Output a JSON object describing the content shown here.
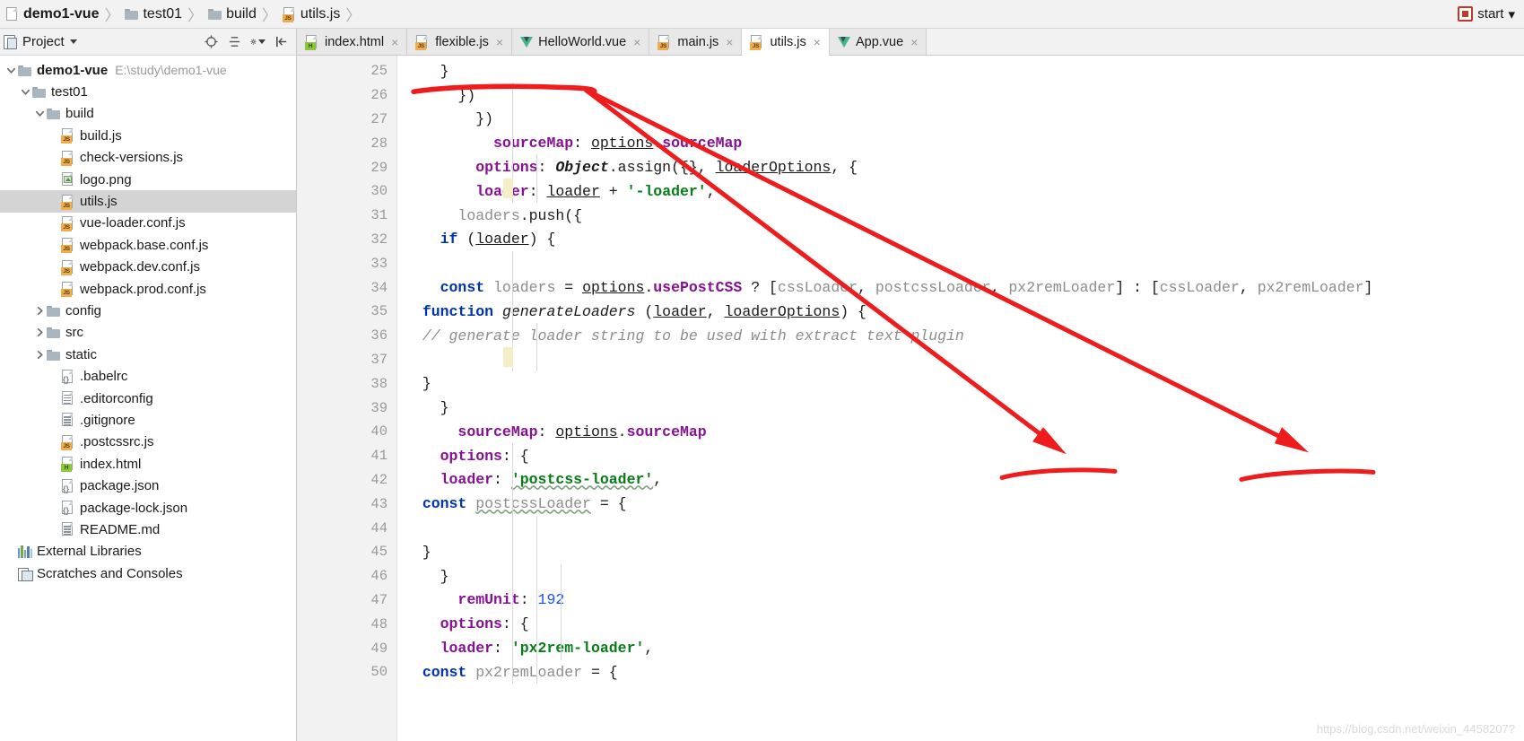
{
  "breadcrumb": {
    "items": [
      {
        "label": "demo1-vue",
        "icon": "module-icon",
        "bold": true
      },
      {
        "label": "test01",
        "icon": "folder-icon",
        "bold": false
      },
      {
        "label": "build",
        "icon": "folder-icon",
        "bold": false
      },
      {
        "label": "utils.js",
        "icon": "js-file-icon",
        "bold": false
      }
    ],
    "separator": "〉",
    "run_config": {
      "label": "start",
      "icon": "run-config-icon",
      "caret": "▾"
    }
  },
  "tool_window": {
    "title": "Project",
    "caret": "▾",
    "actions": [
      {
        "name": "locate-icon",
        "glyph": "⊕"
      },
      {
        "name": "expand-collapse-icon",
        "glyph": "≡"
      },
      {
        "name": "settings-gear-icon",
        "glyph": "⚙"
      },
      {
        "name": "hide-panel-icon",
        "glyph": "⇤"
      }
    ]
  },
  "tree": {
    "items": [
      {
        "label": "demo1-vue",
        "note": "E:\\study\\demo1-vue",
        "icon": "folder-icon",
        "indent": 0,
        "twisty": "down",
        "bold": true,
        "selected": false
      },
      {
        "label": "test01",
        "note": "",
        "icon": "folder-icon",
        "indent": 1,
        "twisty": "down",
        "bold": false,
        "selected": false
      },
      {
        "label": "build",
        "note": "",
        "icon": "folder-icon",
        "indent": 2,
        "twisty": "down",
        "bold": false,
        "selected": false
      },
      {
        "label": "build.js",
        "note": "",
        "icon": "js-file-icon",
        "indent": 3,
        "twisty": "none",
        "bold": false,
        "selected": false
      },
      {
        "label": "check-versions.js",
        "note": "",
        "icon": "js-file-icon",
        "indent": 3,
        "twisty": "none",
        "bold": false,
        "selected": false
      },
      {
        "label": "logo.png",
        "note": "",
        "icon": "image-file-icon",
        "indent": 3,
        "twisty": "none",
        "bold": false,
        "selected": false
      },
      {
        "label": "utils.js",
        "note": "",
        "icon": "js-file-icon",
        "indent": 3,
        "twisty": "none",
        "bold": false,
        "selected": true
      },
      {
        "label": "vue-loader.conf.js",
        "note": "",
        "icon": "js-file-icon",
        "indent": 3,
        "twisty": "none",
        "bold": false,
        "selected": false
      },
      {
        "label": "webpack.base.conf.js",
        "note": "",
        "icon": "js-file-icon",
        "indent": 3,
        "twisty": "none",
        "bold": false,
        "selected": false
      },
      {
        "label": "webpack.dev.conf.js",
        "note": "",
        "icon": "js-file-icon",
        "indent": 3,
        "twisty": "none",
        "bold": false,
        "selected": false
      },
      {
        "label": "webpack.prod.conf.js",
        "note": "",
        "icon": "js-file-icon",
        "indent": 3,
        "twisty": "none",
        "bold": false,
        "selected": false
      },
      {
        "label": "config",
        "note": "",
        "icon": "folder-icon",
        "indent": 2,
        "twisty": "right",
        "bold": false,
        "selected": false
      },
      {
        "label": "src",
        "note": "",
        "icon": "folder-icon",
        "indent": 2,
        "twisty": "right",
        "bold": false,
        "selected": false
      },
      {
        "label": "static",
        "note": "",
        "icon": "folder-icon",
        "indent": 2,
        "twisty": "right",
        "bold": false,
        "selected": false
      },
      {
        "label": ".babelrc",
        "note": "",
        "icon": "json-file-icon",
        "indent": 3,
        "twisty": "none",
        "bold": false,
        "selected": false
      },
      {
        "label": ".editorconfig",
        "note": "",
        "icon": "text-file-icon",
        "indent": 3,
        "twisty": "none",
        "bold": false,
        "selected": false
      },
      {
        "label": ".gitignore",
        "note": "",
        "icon": "text-file-icon",
        "indent": 3,
        "twisty": "none",
        "bold": false,
        "selected": false
      },
      {
        "label": ".postcssrc.js",
        "note": "",
        "icon": "js-file-icon",
        "indent": 3,
        "twisty": "none",
        "bold": false,
        "selected": false
      },
      {
        "label": "index.html",
        "note": "",
        "icon": "html-file-icon",
        "indent": 3,
        "twisty": "none",
        "bold": false,
        "selected": false
      },
      {
        "label": "package.json",
        "note": "",
        "icon": "json-file-icon",
        "indent": 3,
        "twisty": "none",
        "bold": false,
        "selected": false
      },
      {
        "label": "package-lock.json",
        "note": "",
        "icon": "json-file-icon",
        "indent": 3,
        "twisty": "none",
        "bold": false,
        "selected": false
      },
      {
        "label": "README.md",
        "note": "",
        "icon": "text-file-icon",
        "indent": 3,
        "twisty": "none",
        "bold": false,
        "selected": false
      },
      {
        "label": "External Libraries",
        "note": "",
        "icon": "libraries-icon",
        "indent": 0,
        "twisty": "none",
        "bold": false,
        "selected": false
      },
      {
        "label": "Scratches and Consoles",
        "note": "",
        "icon": "scratches-icon",
        "indent": 0,
        "twisty": "none",
        "bold": false,
        "selected": false
      }
    ]
  },
  "editor_tabs": [
    {
      "label": "index.html",
      "icon": "html-file-icon",
      "active": false,
      "close": "×"
    },
    {
      "label": "flexible.js",
      "icon": "js-file-icon",
      "active": false,
      "close": "×"
    },
    {
      "label": "HelloWorld.vue",
      "icon": "vue-file-icon",
      "active": false,
      "close": "×"
    },
    {
      "label": "main.js",
      "icon": "js-file-icon",
      "active": false,
      "close": "×"
    },
    {
      "label": "utils.js",
      "icon": "js-file-icon",
      "active": true,
      "close": "×"
    },
    {
      "label": "App.vue",
      "icon": "vue-file-icon",
      "active": false,
      "close": "×"
    }
  ],
  "code": {
    "first_line_number": 25,
    "lines": [
      {
        "num": 25,
        "fold": "minus",
        "tokens": [
          {
            "t": "  ",
            "c": "p"
          },
          {
            "t": "const",
            "c": "k"
          },
          {
            "t": " ",
            "c": "p"
          },
          {
            "t": "px2remLoader",
            "c": "id"
          },
          {
            "t": " = {",
            "c": "p"
          }
        ]
      },
      {
        "num": 26,
        "fold": "none",
        "tokens": [
          {
            "t": "    ",
            "c": "p"
          },
          {
            "t": "loader",
            "c": "pr"
          },
          {
            "t": ": ",
            "c": "p"
          },
          {
            "t": "'px2rem-loader'",
            "c": "s"
          },
          {
            "t": ",",
            "c": "p"
          }
        ]
      },
      {
        "num": 27,
        "fold": "minus",
        "tokens": [
          {
            "t": "    ",
            "c": "p"
          },
          {
            "t": "options",
            "c": "pr"
          },
          {
            "t": ": {",
            "c": "p"
          }
        ]
      },
      {
        "num": 28,
        "fold": "none",
        "tokens": [
          {
            "t": "      ",
            "c": "p"
          },
          {
            "t": "remUnit",
            "c": "pr"
          },
          {
            "t": ": ",
            "c": "p"
          },
          {
            "t": "192",
            "c": "n"
          }
        ]
      },
      {
        "num": 29,
        "fold": "end",
        "tokens": [
          {
            "t": "    }",
            "c": "p"
          }
        ]
      },
      {
        "num": 30,
        "fold": "end",
        "tokens": [
          {
            "t": "  }",
            "c": "p"
          }
        ]
      },
      {
        "num": 31,
        "fold": "none",
        "tokens": []
      },
      {
        "num": 32,
        "fold": "minus",
        "tokens": [
          {
            "t": "  ",
            "c": "p"
          },
          {
            "t": "const",
            "c": "k"
          },
          {
            "t": " ",
            "c": "p"
          },
          {
            "t": "postcssLoader",
            "c": "id wavy"
          },
          {
            "t": " = {",
            "c": "p"
          }
        ]
      },
      {
        "num": 33,
        "fold": "none",
        "tokens": [
          {
            "t": "    ",
            "c": "p"
          },
          {
            "t": "loader",
            "c": "pr"
          },
          {
            "t": ": ",
            "c": "p"
          },
          {
            "t": "'postcss-loader'",
            "c": "s wavy"
          },
          {
            "t": ",",
            "c": "p"
          }
        ]
      },
      {
        "num": 34,
        "fold": "minus",
        "tokens": [
          {
            "t": "    ",
            "c": "p"
          },
          {
            "t": "options",
            "c": "pr"
          },
          {
            "t": ": {",
            "c": "p"
          }
        ]
      },
      {
        "num": 35,
        "fold": "none",
        "tokens": [
          {
            "t": "      ",
            "c": "p"
          },
          {
            "t": "sourceMap",
            "c": "pr"
          },
          {
            "t": ": ",
            "c": "p"
          },
          {
            "t": "options",
            "c": "par"
          },
          {
            "t": ".",
            "c": "p"
          },
          {
            "t": "sourceMap",
            "c": "pr"
          }
        ]
      },
      {
        "num": 36,
        "fold": "end",
        "tokens": [
          {
            "t": "    }",
            "c": "p"
          }
        ]
      },
      {
        "num": 37,
        "fold": "end",
        "tokens": [
          {
            "t": "  }",
            "c": "p"
          }
        ]
      },
      {
        "num": 38,
        "fold": "none",
        "tokens": []
      },
      {
        "num": 39,
        "fold": "none",
        "tokens": [
          {
            "t": "  ",
            "c": "p"
          },
          {
            "t": "// generate loader string to be used with extract text plugin",
            "c": "cm"
          }
        ]
      },
      {
        "num": 40,
        "fold": "minus",
        "tokens": [
          {
            "t": "  ",
            "c": "p"
          },
          {
            "t": "function",
            "c": "k"
          },
          {
            "t": " ",
            "c": "p"
          },
          {
            "t": "generateLoaders",
            "c": "fn"
          },
          {
            "t": " (",
            "c": "p"
          },
          {
            "t": "loader",
            "c": "par"
          },
          {
            "t": ", ",
            "c": "p"
          },
          {
            "t": "loaderOptions",
            "c": "par"
          },
          {
            "t": ") {",
            "c": "p"
          }
        ]
      },
      {
        "num": 41,
        "fold": "none",
        "tokens": [
          {
            "t": "    ",
            "c": "p"
          },
          {
            "t": "const",
            "c": "k"
          },
          {
            "t": " ",
            "c": "p"
          },
          {
            "t": "loaders",
            "c": "id"
          },
          {
            "t": " = ",
            "c": "p"
          },
          {
            "t": "options",
            "c": "par"
          },
          {
            "t": ".",
            "c": "p"
          },
          {
            "t": "usePostCSS",
            "c": "pr"
          },
          {
            "t": " ? [",
            "c": "p"
          },
          {
            "t": "cssLoader",
            "c": "id"
          },
          {
            "t": ", ",
            "c": "p"
          },
          {
            "t": "postcssLoader",
            "c": "id"
          },
          {
            "t": ", ",
            "c": "p"
          },
          {
            "t": "px2remLoader",
            "c": "id"
          },
          {
            "t": "] : [",
            "c": "p"
          },
          {
            "t": "cssLoader",
            "c": "id"
          },
          {
            "t": ", ",
            "c": "p"
          },
          {
            "t": "px2remLoader",
            "c": "id"
          },
          {
            "t": "]",
            "c": "p"
          }
        ]
      },
      {
        "num": 42,
        "fold": "none",
        "tokens": []
      },
      {
        "num": 43,
        "fold": "minus",
        "tokens": [
          {
            "t": "    ",
            "c": "p"
          },
          {
            "t": "if",
            "c": "k"
          },
          {
            "t": " (",
            "c": "p"
          },
          {
            "t": "loader",
            "c": "par"
          },
          {
            "t": ") {",
            "c": "p"
          }
        ]
      },
      {
        "num": 44,
        "fold": "minus",
        "tokens": [
          {
            "t": "      ",
            "c": "p"
          },
          {
            "t": "loaders",
            "c": "id"
          },
          {
            "t": ".",
            "c": "p"
          },
          {
            "t": "push",
            "c": "p"
          },
          {
            "t": "({",
            "c": "p"
          }
        ]
      },
      {
        "num": 45,
        "fold": "none",
        "tokens": [
          {
            "t": "        ",
            "c": "p"
          },
          {
            "t": "loader",
            "c": "pr"
          },
          {
            "t": ": ",
            "c": "p"
          },
          {
            "t": "loader",
            "c": "par"
          },
          {
            "t": " + ",
            "c": "p"
          },
          {
            "t": "'-loader'",
            "c": "s"
          },
          {
            "t": ",",
            "c": "p"
          }
        ]
      },
      {
        "num": 46,
        "fold": "minus",
        "tokens": [
          {
            "t": "        ",
            "c": "p"
          },
          {
            "t": "options",
            "c": "pr"
          },
          {
            "t": ": ",
            "c": "p"
          },
          {
            "t": "Object",
            "c": "gl"
          },
          {
            "t": ".",
            "c": "p"
          },
          {
            "t": "assign",
            "c": "p"
          },
          {
            "t": "({}, ",
            "c": "p"
          },
          {
            "t": "loaderOptions",
            "c": "par"
          },
          {
            "t": ", {",
            "c": "p"
          }
        ]
      },
      {
        "num": 47,
        "fold": "none",
        "tokens": [
          {
            "t": "          ",
            "c": "p"
          },
          {
            "t": "sourceMap",
            "c": "pr"
          },
          {
            "t": ": ",
            "c": "p"
          },
          {
            "t": "options",
            "c": "par"
          },
          {
            "t": ".",
            "c": "p"
          },
          {
            "t": "sourceMap",
            "c": "pr"
          }
        ]
      },
      {
        "num": 48,
        "fold": "end",
        "tokens": [
          {
            "t": "        })",
            "c": "p"
          }
        ]
      },
      {
        "num": 49,
        "fold": "end",
        "tokens": [
          {
            "t": "      })",
            "c": "p"
          }
        ]
      },
      {
        "num": 50,
        "fold": "end",
        "tokens": [
          {
            "t": "    }",
            "c": "p"
          }
        ]
      }
    ]
  },
  "annotations": {
    "color": "#ee1c1c",
    "marks": [
      {
        "name": "underline-px2remloader-decl",
        "type": "underline"
      },
      {
        "name": "arrow-to-px2remloader-first",
        "type": "arrow"
      },
      {
        "name": "arrow-to-px2remloader-second",
        "type": "arrow"
      },
      {
        "name": "underline-px2remloader-first-usage",
        "type": "underline"
      },
      {
        "name": "underline-px2remloader-second-usage",
        "type": "underline"
      }
    ]
  },
  "watermark": {
    "text": "https://blog.csdn.net/weixin_4458207?"
  }
}
